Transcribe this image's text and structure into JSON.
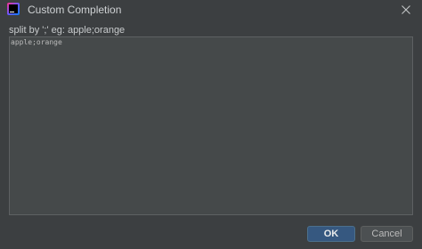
{
  "window": {
    "title": "Custom Completion",
    "app_icon": "ide-app-icon",
    "close_icon": "close-icon"
  },
  "form": {
    "prompt": "split by ';' eg: apple;orange",
    "editor_value": "apple;orange"
  },
  "buttons": {
    "ok_label": "OK",
    "cancel_label": "Cancel"
  },
  "colors": {
    "background": "#3c3f41",
    "editor_background": "#45494a",
    "primary_button": "#365880",
    "secondary_button": "#4c5052"
  }
}
